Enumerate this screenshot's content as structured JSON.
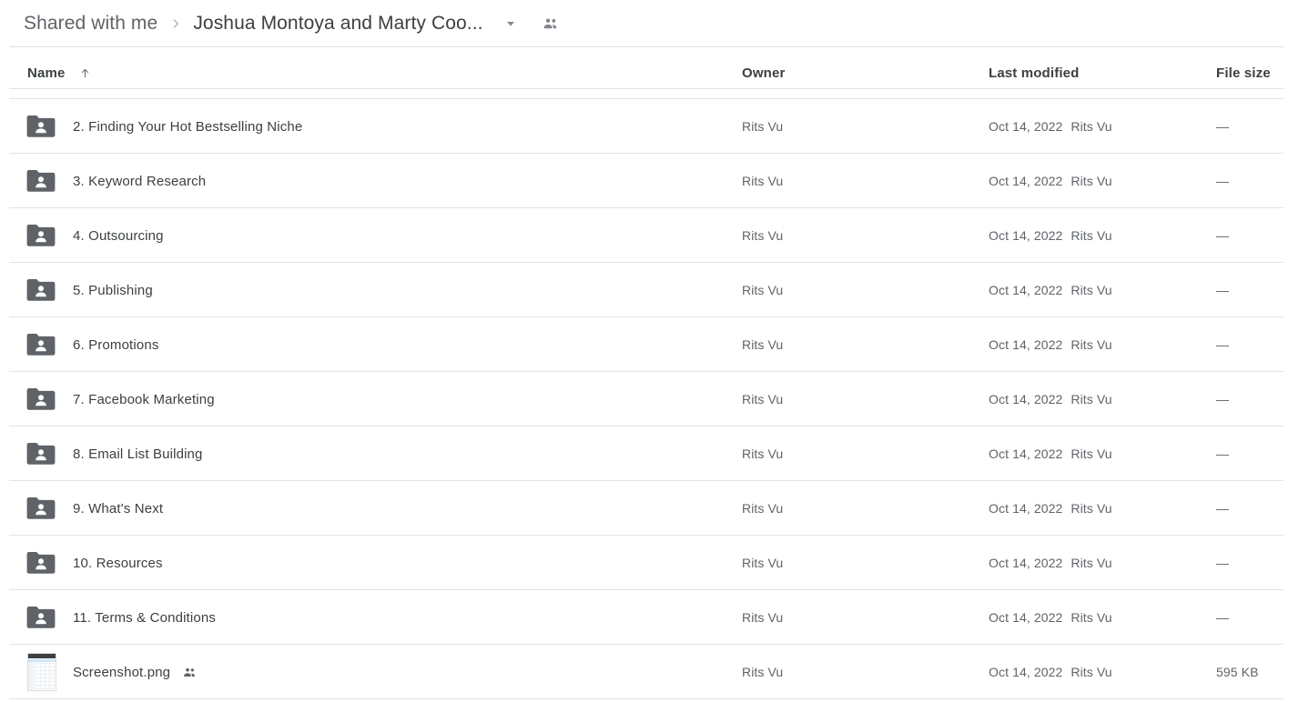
{
  "breadcrumb": {
    "root_label": "Shared with me",
    "separator_icon": "chevron-right-icon",
    "current_label": "Joshua Montoya and Marty Coo...",
    "caret_icon": "chevron-down-icon",
    "people_icon": "people-icon"
  },
  "columns": {
    "name": "Name",
    "sort_icon": "arrow-up-icon",
    "owner": "Owner",
    "last_modified": "Last modified",
    "file_size": "File size"
  },
  "colors": {
    "folder_icon": "#5f6368",
    "text_primary": "#3c4043",
    "text_secondary": "#5f6368",
    "divider": "#e3e3e3"
  },
  "rows": [
    {
      "icon": "shared-folder-icon",
      "name": "2. Finding Your Hot Bestselling Niche",
      "shared": false,
      "owner": "Rits Vu",
      "modified_date": "Oct 14, 2022",
      "modified_by": "Rits Vu",
      "size": "—"
    },
    {
      "icon": "shared-folder-icon",
      "name": "3. Keyword Research",
      "shared": false,
      "owner": "Rits Vu",
      "modified_date": "Oct 14, 2022",
      "modified_by": "Rits Vu",
      "size": "—"
    },
    {
      "icon": "shared-folder-icon",
      "name": "4. Outsourcing",
      "shared": false,
      "owner": "Rits Vu",
      "modified_date": "Oct 14, 2022",
      "modified_by": "Rits Vu",
      "size": "—"
    },
    {
      "icon": "shared-folder-icon",
      "name": "5. Publishing",
      "shared": false,
      "owner": "Rits Vu",
      "modified_date": "Oct 14, 2022",
      "modified_by": "Rits Vu",
      "size": "—"
    },
    {
      "icon": "shared-folder-icon",
      "name": "6. Promotions",
      "shared": false,
      "owner": "Rits Vu",
      "modified_date": "Oct 14, 2022",
      "modified_by": "Rits Vu",
      "size": "—"
    },
    {
      "icon": "shared-folder-icon",
      "name": "7. Facebook Marketing",
      "shared": false,
      "owner": "Rits Vu",
      "modified_date": "Oct 14, 2022",
      "modified_by": "Rits Vu",
      "size": "—"
    },
    {
      "icon": "shared-folder-icon",
      "name": "8. Email List Building",
      "shared": false,
      "owner": "Rits Vu",
      "modified_date": "Oct 14, 2022",
      "modified_by": "Rits Vu",
      "size": "—"
    },
    {
      "icon": "shared-folder-icon",
      "name": "9. What's Next",
      "shared": false,
      "owner": "Rits Vu",
      "modified_date": "Oct 14, 2022",
      "modified_by": "Rits Vu",
      "size": "—"
    },
    {
      "icon": "shared-folder-icon",
      "name": "10. Resources",
      "shared": false,
      "owner": "Rits Vu",
      "modified_date": "Oct 14, 2022",
      "modified_by": "Rits Vu",
      "size": "—"
    },
    {
      "icon": "shared-folder-icon",
      "name": "11. Terms & Conditions",
      "shared": false,
      "owner": "Rits Vu",
      "modified_date": "Oct 14, 2022",
      "modified_by": "Rits Vu",
      "size": "—"
    },
    {
      "icon": "image-thumbnail-icon",
      "name": "Screenshot.png",
      "shared": true,
      "shared_icon": "people-icon",
      "owner": "Rits Vu",
      "modified_date": "Oct 14, 2022",
      "modified_by": "Rits Vu",
      "size": "595 KB"
    }
  ]
}
